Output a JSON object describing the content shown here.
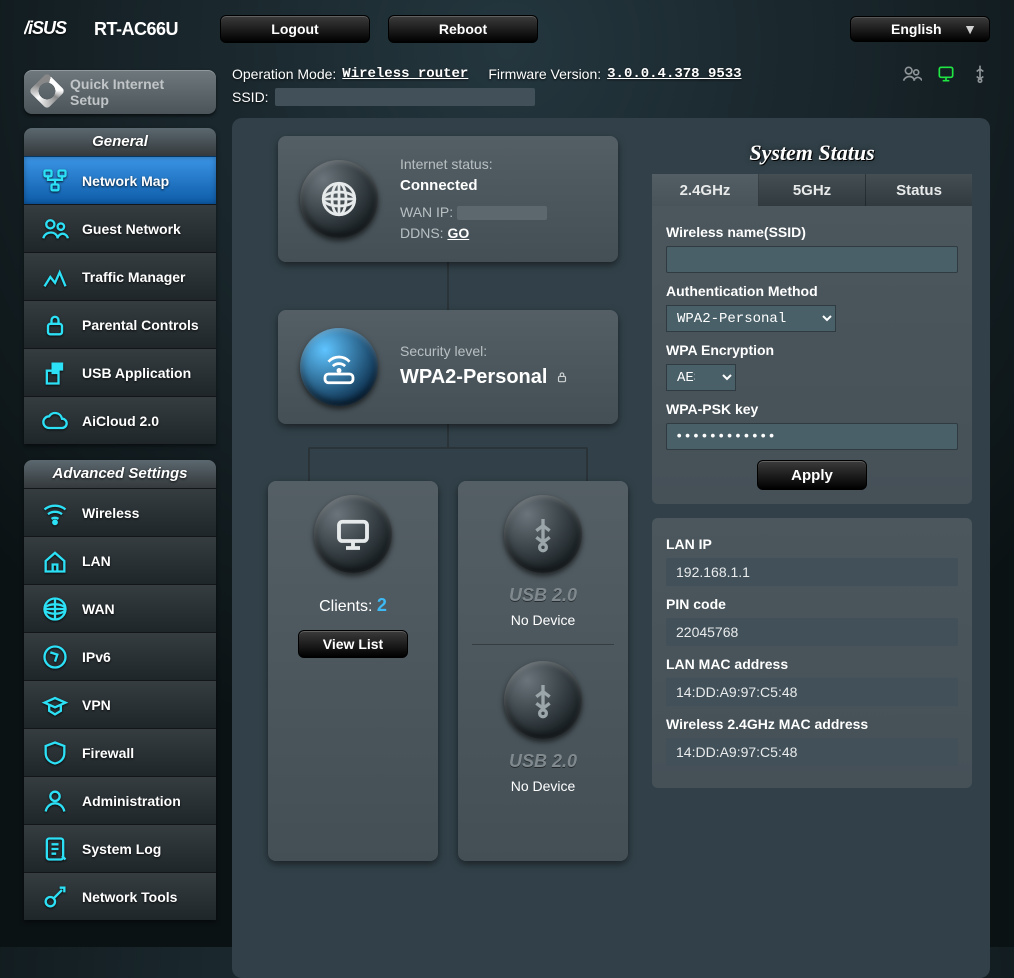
{
  "header": {
    "brand": "ASUS",
    "model": "RT-AC66U",
    "logout": "Logout",
    "reboot": "Reboot",
    "language": "English",
    "op_mode_label": "Operation Mode:",
    "op_mode_value": "Wireless router",
    "fw_label": "Firmware Version:",
    "fw_value": "3.0.0.4.378_9533",
    "ssid_label": "SSID:",
    "ssid_value": ""
  },
  "qis": "Quick Internet Setup",
  "nav_general": {
    "title": "General",
    "items": [
      "Network Map",
      "Guest Network",
      "Traffic Manager",
      "Parental Controls",
      "USB Application",
      "AiCloud 2.0"
    ],
    "active_index": 0
  },
  "nav_advanced": {
    "title": "Advanced Settings",
    "items": [
      "Wireless",
      "LAN",
      "WAN",
      "IPv6",
      "VPN",
      "Firewall",
      "Administration",
      "System Log",
      "Network Tools"
    ]
  },
  "internet": {
    "status_label": "Internet status:",
    "status": "Connected",
    "wan_label": "WAN IP:",
    "wan_ip": "",
    "ddns_label": "DDNS:",
    "ddns_link": "GO"
  },
  "security": {
    "label": "Security level:",
    "value": "WPA2-Personal"
  },
  "clients": {
    "label": "Clients:",
    "count": "2",
    "view_list": "View List"
  },
  "usb": {
    "port1_label": "USB 2.0",
    "port1_status": "No Device",
    "port2_label": "USB 2.0",
    "port2_status": "No Device"
  },
  "status_panel": {
    "title": "System Status",
    "tabs": [
      "2.4GHz",
      "5GHz",
      "Status"
    ],
    "active_tab": 0,
    "ssid_label": "Wireless name(SSID)",
    "ssid_value": "",
    "auth_label": "Authentication Method",
    "auth_value": "WPA2-Personal",
    "enc_label": "WPA Encryption",
    "enc_value": "AES",
    "psk_label": "WPA-PSK key",
    "psk_value": "••••••••••••",
    "apply": "Apply",
    "lan_ip_label": "LAN IP",
    "lan_ip": "192.168.1.1",
    "pin_label": "PIN code",
    "pin": "22045768",
    "lan_mac_label": "LAN MAC address",
    "lan_mac": "14:DD:A9:97:C5:48",
    "wmac_label": "Wireless 2.4GHz MAC address",
    "wmac": "14:DD:A9:97:C5:48"
  }
}
